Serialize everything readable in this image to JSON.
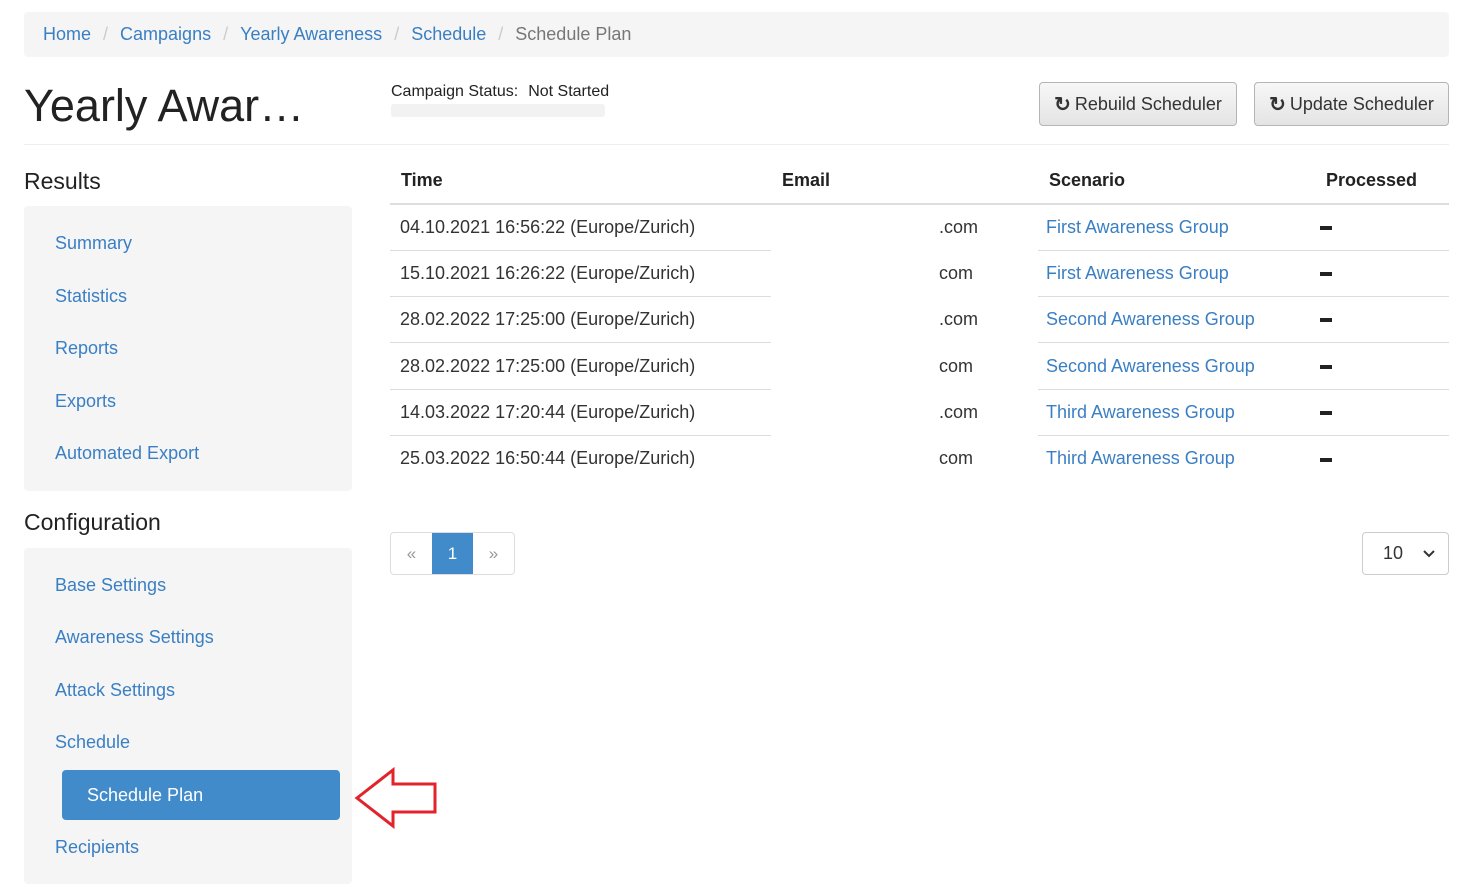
{
  "breadcrumb": [
    "Home",
    "Campaigns",
    "Yearly Awareness",
    "Schedule",
    "Schedule Plan"
  ],
  "page_title": "Yearly Awar…",
  "campaign_status": {
    "label": "Campaign Status:",
    "value": "Not Started"
  },
  "buttons": {
    "rebuild": "Rebuild Scheduler",
    "update": "Update Scheduler"
  },
  "results": {
    "title": "Results",
    "items": [
      "Summary",
      "Statistics",
      "Reports",
      "Exports",
      "Automated Export"
    ]
  },
  "configuration": {
    "title": "Configuration",
    "items": [
      "Base Settings",
      "Awareness Settings",
      "Attack Settings",
      "Schedule",
      "Schedule Plan",
      "Recipients"
    ],
    "active": "Schedule Plan"
  },
  "table": {
    "headers": [
      "Time",
      "Email",
      "Scenario",
      "Processed"
    ],
    "rows": [
      {
        "time": "04.10.2021 16:56:22 (Europe/Zurich)",
        "email": ".com",
        "scenario": "First Awareness Group"
      },
      {
        "time": "15.10.2021 16:26:22 (Europe/Zurich)",
        "email": "com",
        "scenario": "First Awareness Group"
      },
      {
        "time": "28.02.2022 17:25:00 (Europe/Zurich)",
        "email": ".com",
        "scenario": "Second Awareness Group"
      },
      {
        "time": "28.02.2022 17:25:00 (Europe/Zurich)",
        "email": "com",
        "scenario": "Second Awareness Group"
      },
      {
        "time": "14.03.2022 17:20:44 (Europe/Zurich)",
        "email": ".com",
        "scenario": "Third Awareness Group"
      },
      {
        "time": "25.03.2022 16:50:44 (Europe/Zurich)",
        "email": "com",
        "scenario": "Third Awareness Group"
      }
    ]
  },
  "pagination": {
    "prev": "«",
    "current": "1",
    "next": "»"
  },
  "per_page": "10",
  "icons": {
    "refresh": "refresh-icon",
    "arrow": "red-arrow-left-icon",
    "chevron": "chevron-down-icon"
  },
  "colors": {
    "link": "#3a7fc4",
    "active": "#428bca",
    "arrow": "#e3232b"
  }
}
